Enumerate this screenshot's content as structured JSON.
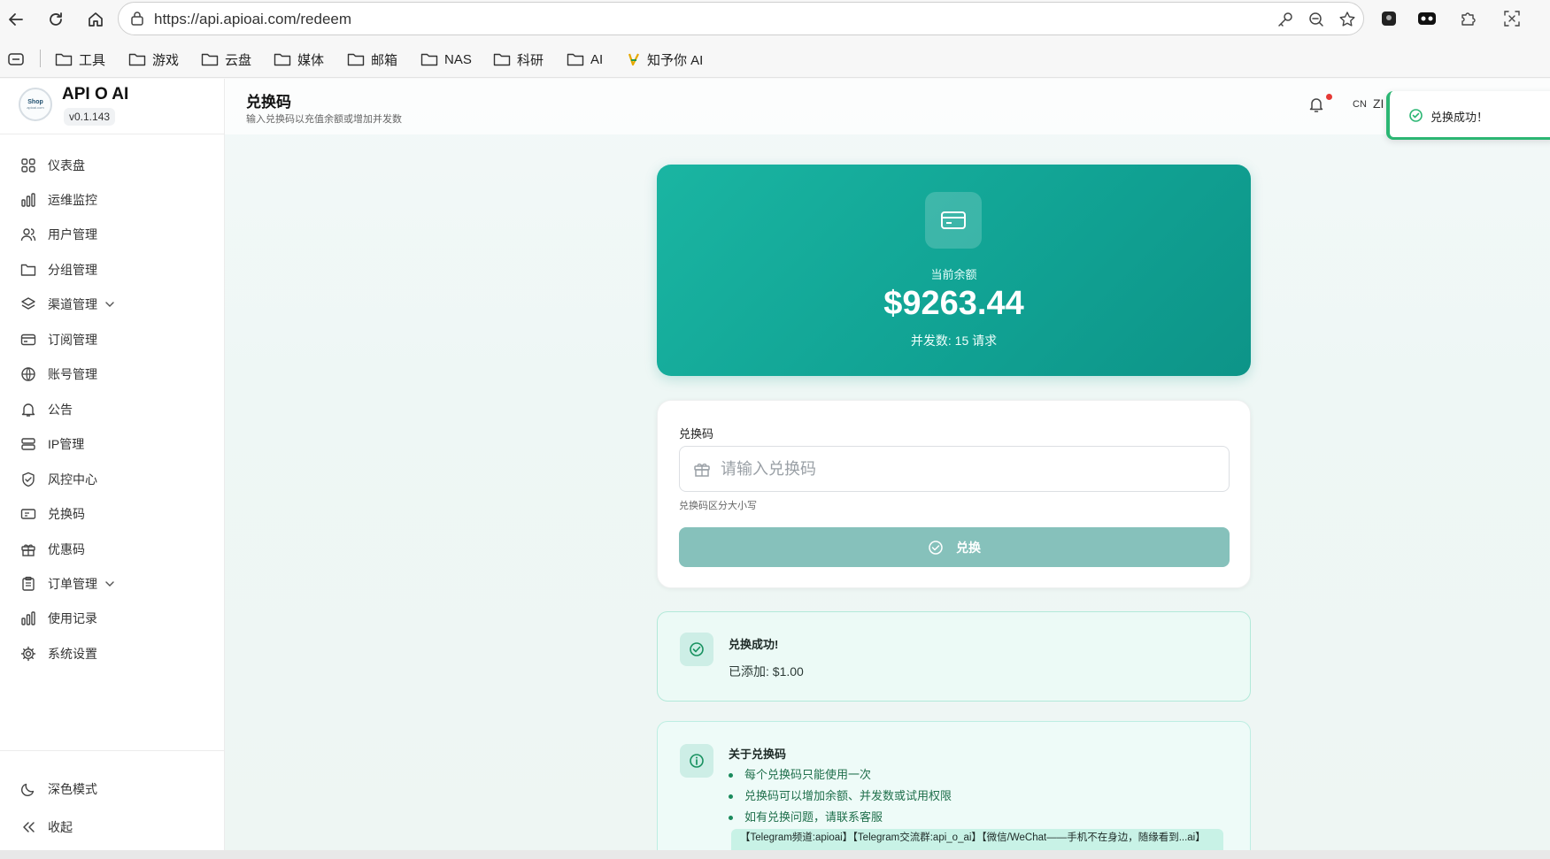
{
  "browser": {
    "url": "https://api.apioai.com/redeem",
    "bookmarks": [
      "工具",
      "游戏",
      "云盘",
      "媒体",
      "邮箱",
      "NAS",
      "科研",
      "AI",
      "知予你 AI"
    ]
  },
  "brand": {
    "name": "API O AI",
    "version": "v0.1.143",
    "logo_text": "Shop",
    "logo_sub": "apioai.com"
  },
  "sidebar": {
    "items": [
      {
        "label": "仪表盘",
        "icon": "dashboard-icon"
      },
      {
        "label": "运维监控",
        "icon": "bar-chart-icon"
      },
      {
        "label": "用户管理",
        "icon": "users-icon"
      },
      {
        "label": "分组管理",
        "icon": "folder-icon"
      },
      {
        "label": "渠道管理",
        "icon": "layers-icon",
        "expandable": true
      },
      {
        "label": "订阅管理",
        "icon": "card-icon"
      },
      {
        "label": "账号管理",
        "icon": "globe-icon"
      },
      {
        "label": "公告",
        "icon": "bell-icon"
      },
      {
        "label": "IP管理",
        "icon": "server-icon"
      },
      {
        "label": "风控中心",
        "icon": "shield-icon"
      },
      {
        "label": "兑换码",
        "icon": "ticket-icon"
      },
      {
        "label": "优惠码",
        "icon": "gift-icon"
      },
      {
        "label": "订单管理",
        "icon": "clipboard-icon",
        "expandable": true
      },
      {
        "label": "使用记录",
        "icon": "bar-chart-icon"
      },
      {
        "label": "系统设置",
        "icon": "gear-icon"
      }
    ],
    "dark_mode": "深色模式",
    "collapse": "收起"
  },
  "header": {
    "title": "兑换码",
    "subtitle": "输入兑换码以充值余额或增加并发数",
    "lang": "CN",
    "lang_partial": "ZI"
  },
  "toast": {
    "message": "兑换成功！",
    "color": "#2bb673"
  },
  "balance": {
    "label": "当前余额",
    "value": "$9263.44",
    "concurrency": "并发数: 15 请求",
    "color": "#11a394"
  },
  "form": {
    "label": "兑换码",
    "placeholder": "请输入兑换码",
    "value": "",
    "hint": "兑换码区分大小写",
    "submit": "兑换"
  },
  "success": {
    "title": "兑换成功!",
    "message": "已添加: $1.00"
  },
  "info": {
    "title": "关于兑换码",
    "items": [
      "每个兑换码只能使用一次",
      "兑换码可以增加余额、并发数或试用权限",
      "如有兑换问题，请联系客服"
    ],
    "contact": "【Telegram频道:apioai】【Telegram交流群:api_o_ai】【微信/WeChat——手机不在身边，随缘看到...ai】"
  }
}
